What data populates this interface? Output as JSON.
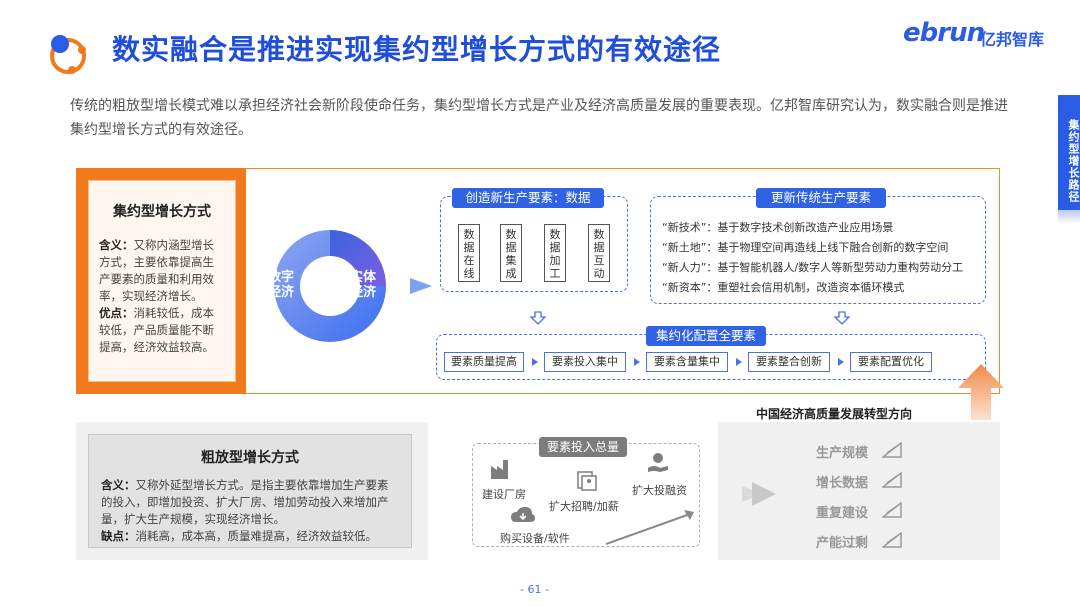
{
  "header": {
    "title": "数实融合是推进实现集约型增长方式的有效途径",
    "brand_latin": "ebrun",
    "brand_cn": "亿邦智库",
    "intro": "传统的粗放型增长模式难以承担经济社会新阶段使命任务，集约型增长方式是产业及经济高质量发展的重要表现。亿邦智库研究认为，数实融合则是推进集约型增长方式的有效途径。",
    "side_tab": "集约型增长路径"
  },
  "intensive": {
    "title": "集约型增长方式",
    "def_label": "含义：",
    "def_text": "又称内涵型增长方式，主要依靠提高生产要素的质量和利用效率，实现经济增长。",
    "adv_label": "优点：",
    "adv_text": "消耗较低，成本较低，产品质量能不断提高，经济效益较高。"
  },
  "cycle": {
    "left": "数字经济",
    "right": "实体经济"
  },
  "new_factors": {
    "title": "创造新生产要素：数据",
    "items": [
      "数据在线",
      "数据集成",
      "数据加工",
      "数据互动"
    ]
  },
  "traditional": {
    "title": "更新传统生产要素",
    "lines": [
      "“新技术”：基于数字技术创新改造产业应用场景",
      "“新土地”：基于物理空间再造线上线下融合创新的数字空间",
      "“新人力”：基于智能机器人/数字人等新型劳动力重构劳动分工",
      "“新资本”：重塑社会信用机制，改造资本循环模式"
    ]
  },
  "config": {
    "title": "集约化配置全要素",
    "steps": [
      "要素质量提高",
      "要素投入集中",
      "要素含量集中",
      "要素整合创新",
      "要素配置优化"
    ]
  },
  "direction_label": "中国经济高质量发展转型方向",
  "extensive": {
    "title": "粗放型增长方式",
    "def_label": "含义：",
    "def_text": "又称外延型增长方式。是指主要依靠增加生产要素的投入，即增加投资、扩大厂房、增加劳动投入来增加产量，扩大生产规模，实现经济增长。",
    "dis_label": "缺点：",
    "dis_text": "消耗高，成本高，质量难提高，经济效益较低。"
  },
  "inputs": {
    "title": "要素投入总量",
    "items": [
      "建设厂房",
      "扩大招聘/加薪",
      "扩大投融资",
      "购买设备/软件"
    ]
  },
  "outcomes": [
    "生产规模",
    "增长数据",
    "重复建设",
    "产能过剩"
  ],
  "page_number": "- 61 -"
}
